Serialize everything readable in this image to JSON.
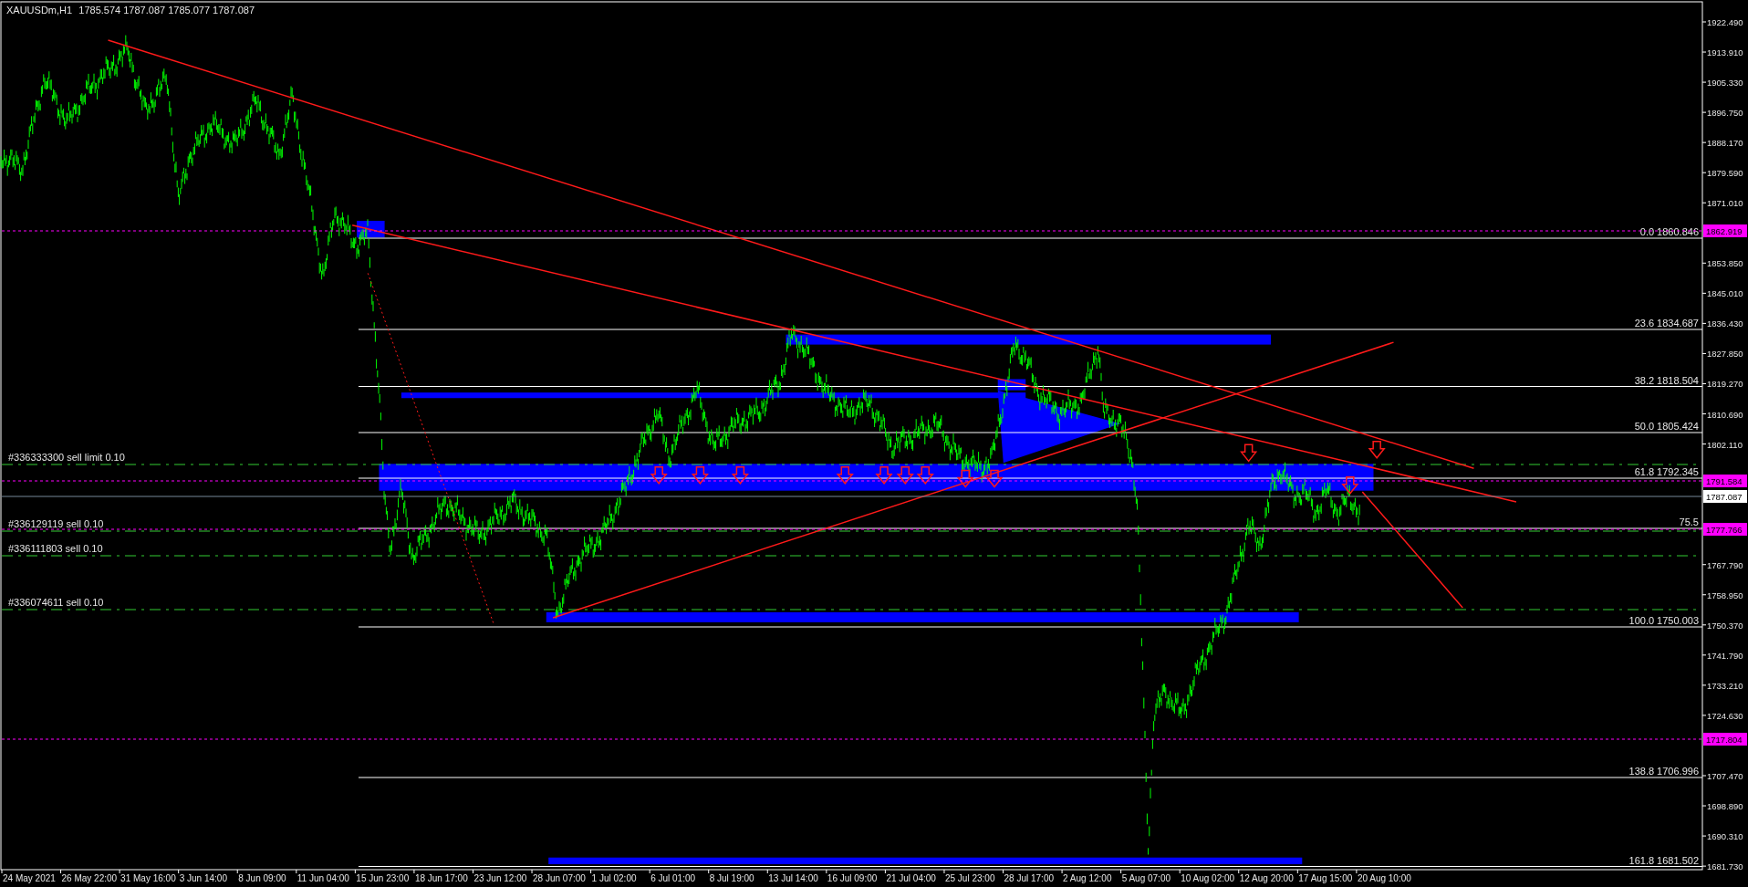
{
  "chart": {
    "symbol": "XAUUSDm,H1",
    "ohlc": "1785.574 1787.087 1785.077 1787.087"
  },
  "price_axis": {
    "ticks": [
      "1922.490",
      "1913.910",
      "1905.330",
      "1896.750",
      "1888.170",
      "1879.590",
      "1871.010",
      "1853.850",
      "1845.010",
      "1836.430",
      "1827.850",
      "1819.270",
      "1810.690",
      "1802.110",
      "1767.790",
      "1758.950",
      "1750.370",
      "1741.790",
      "1733.210",
      "1724.630",
      "1707.470",
      "1698.890",
      "1690.310",
      "1681.730"
    ]
  },
  "time_axis": {
    "labels": [
      "24 May 2021",
      "26 May 22:00",
      "31 May 16:00",
      "3 Jun 14:00",
      "8 Jun 09:00",
      "11 Jun 04:00",
      "15 Jun 23:00",
      "18 Jun 17:00",
      "23 Jun 12:00",
      "28 Jun 07:00",
      "1 Jul 02:00",
      "6 Jul 01:00",
      "8 Jul 19:00",
      "13 Jul 14:00",
      "16 Jul 09:00",
      "21 Jul 04:00",
      "25 Jul 23:00",
      "28 Jul 17:00",
      "2 Aug 12:00",
      "5 Aug 07:00",
      "10 Aug 02:00",
      "12 Aug 20:00",
      "17 Aug 15:00",
      "20 Aug 10:00"
    ]
  },
  "fibonacci_levels": [
    {
      "label": "0.0 1860.846"
    },
    {
      "label": "23.6 1834.687"
    },
    {
      "label": "38.2 1818.504"
    },
    {
      "label": "50.0 1805.424"
    },
    {
      "label": "61.8 1792.345"
    },
    {
      "label": "75.5"
    },
    {
      "label": "100.0 1750.003"
    },
    {
      "label": "138.8 1706.996"
    },
    {
      "label": "161.8 1681.502"
    }
  ],
  "orders": [
    {
      "label": "#336333300 sell limit 0.10"
    },
    {
      "label": "#336129119 sell 0.10"
    },
    {
      "label": "#336111803 sell 0.10"
    },
    {
      "label": "#336074611 sell 0.10"
    }
  ],
  "price_tags": [
    {
      "value": "1862.919",
      "kind": "alert"
    },
    {
      "value": "1791.584",
      "kind": "alert"
    },
    {
      "value": "1787.087",
      "kind": "bid"
    },
    {
      "value": "1777.766",
      "kind": "alert"
    },
    {
      "value": "1717.804",
      "kind": "alert"
    }
  ]
}
